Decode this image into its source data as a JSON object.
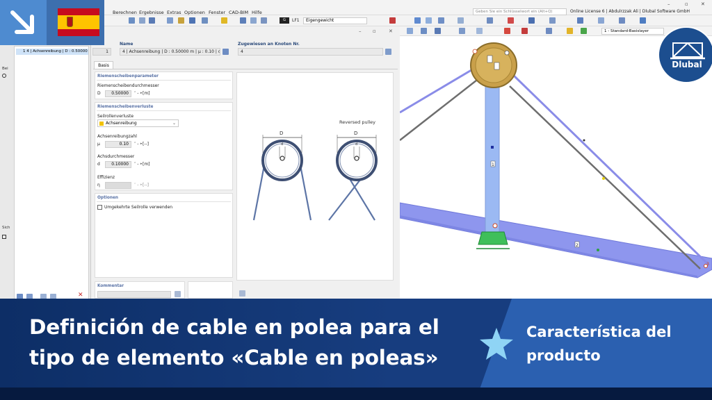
{
  "menubar": {
    "items": [
      "Berechnen",
      "Ergebnisse",
      "Extras",
      "Optionen",
      "Fenster",
      "CAD-BIM",
      "Hilfe"
    ],
    "search_placeholder": "Geben Sie ein Schlüsselwort ein (Alt+Q)",
    "license": "Online License 6 | Abdulrzzak Ali | Dlubal Software GmbH"
  },
  "toolbar": {
    "load_chip": "G",
    "load_case": "LF1",
    "load_case_name": "Eigengewicht",
    "layer": "1 - Standard-Basislayer"
  },
  "navigator": {
    "row_number": "1",
    "row_label": "4 | Achsenreibung | D : 0.50000",
    "side_label_1": "Bei",
    "side_label_2": "Sich"
  },
  "dialog": {
    "no_value": "1",
    "name_title": "Name",
    "name_value": "4 | Achsenreibung | D : 0.50000 m | µ : 0.10 | d : 0.100",
    "assigned_title": "Zugewiesen an Knoten Nr.",
    "assigned_value": "4",
    "tab_label": "Basis",
    "params": {
      "header": "Riemenscheibenparameter",
      "diameter_label": "Riemenscheibendurchmesser",
      "diameter_symbol": "D",
      "diameter_value": "0.50000",
      "diameter_unit": "[m]"
    },
    "losses": {
      "header": "Riemenscheibenverluste",
      "type_label": "Seilrollenverluste",
      "type_value": "Achsenreibung",
      "friction_label": "Achsenreibungzahl",
      "friction_symbol": "µ",
      "friction_value": "0.10",
      "friction_unit": "[--]",
      "axle_label": "Achsdurchmesser",
      "axle_symbol": "d",
      "axle_value": "0.10000",
      "axle_unit": "[m]",
      "eff_label": "Effizienz",
      "eff_symbol": "η",
      "eff_unit": "[--]"
    },
    "options": {
      "header": "Optionen",
      "reverse_label": "Umgekehrte Seilrolle verwenden"
    },
    "comment_title": "Kommentar",
    "preview": {
      "reversed_caption": "Reversed pulley",
      "dim_d_left": "D",
      "dim_d_right": "D",
      "small_d_left": "d",
      "small_d_right": "d"
    }
  },
  "view3d": {
    "member_labels": [
      "1",
      "2"
    ],
    "node_label": "3"
  },
  "branding": {
    "logo_text": "Dlubal",
    "title_line1": "Definición de cable en polea para el",
    "title_line2": "tipo de elemento «Cable en poleas»",
    "tag_line1": "Característica del",
    "tag_line2": "producto"
  }
}
